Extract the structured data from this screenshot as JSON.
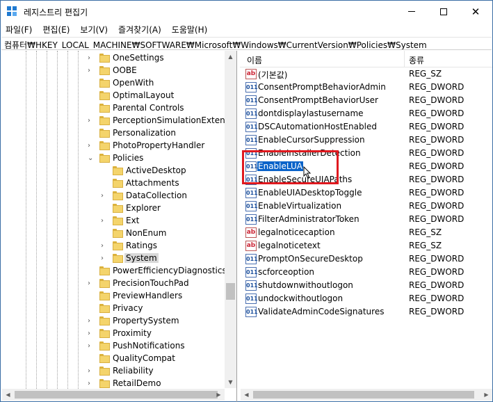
{
  "window": {
    "title": "레지스트리 편집기",
    "brand_color": "#1f7ad1"
  },
  "menu": [
    {
      "label": "파일(F)"
    },
    {
      "label": "편집(E)"
    },
    {
      "label": "보기(V)"
    },
    {
      "label": "즐겨찾기(A)"
    },
    {
      "label": "도움말(H)"
    }
  ],
  "address": {
    "path": "컴퓨터₩HKEY_LOCAL_MACHINE₩SOFTWARE₩Microsoft₩Windows₩CurrentVersion₩Policies₩System"
  },
  "tree": {
    "items": [
      {
        "label": "OneSettings",
        "level": 0,
        "expander": "collapsed"
      },
      {
        "label": "OOBE",
        "level": 0,
        "expander": "collapsed"
      },
      {
        "label": "OpenWith",
        "level": 0,
        "expander": "none"
      },
      {
        "label": "OptimalLayout",
        "level": 0,
        "expander": "none"
      },
      {
        "label": "Parental Controls",
        "level": 0,
        "expander": "none"
      },
      {
        "label": "PerceptionSimulationExtensions",
        "level": 0,
        "expander": "collapsed"
      },
      {
        "label": "Personalization",
        "level": 0,
        "expander": "none"
      },
      {
        "label": "PhotoPropertyHandler",
        "level": 0,
        "expander": "collapsed"
      },
      {
        "label": "Policies",
        "level": 0,
        "expander": "expanded"
      },
      {
        "label": "ActiveDesktop",
        "level": 1,
        "expander": "none"
      },
      {
        "label": "Attachments",
        "level": 1,
        "expander": "none"
      },
      {
        "label": "DataCollection",
        "level": 1,
        "expander": "collapsed"
      },
      {
        "label": "Explorer",
        "level": 1,
        "expander": "none"
      },
      {
        "label": "Ext",
        "level": 1,
        "expander": "collapsed"
      },
      {
        "label": "NonEnum",
        "level": 1,
        "expander": "none"
      },
      {
        "label": "Ratings",
        "level": 1,
        "expander": "collapsed"
      },
      {
        "label": "System",
        "level": 1,
        "expander": "collapsed",
        "selected": true
      },
      {
        "label": "PowerEfficiencyDiagnostics",
        "level": 0,
        "expander": "none"
      },
      {
        "label": "PrecisionTouchPad",
        "level": 0,
        "expander": "collapsed"
      },
      {
        "label": "PreviewHandlers",
        "level": 0,
        "expander": "none"
      },
      {
        "label": "Privacy",
        "level": 0,
        "expander": "none"
      },
      {
        "label": "PropertySystem",
        "level": 0,
        "expander": "collapsed"
      },
      {
        "label": "Proximity",
        "level": 0,
        "expander": "collapsed"
      },
      {
        "label": "PushNotifications",
        "level": 0,
        "expander": "collapsed"
      },
      {
        "label": "QualityCompat",
        "level": 0,
        "expander": "none"
      },
      {
        "label": "Reliability",
        "level": 0,
        "expander": "collapsed"
      },
      {
        "label": "RetailDemo",
        "level": 0,
        "expander": "collapsed"
      }
    ]
  },
  "list": {
    "columns": {
      "name": "이름",
      "type": "종류"
    },
    "values": [
      {
        "name": "(기본값)",
        "type": "REG_SZ",
        "kind": "sz"
      },
      {
        "name": "ConsentPromptBehaviorAdmin",
        "type": "REG_DWORD",
        "kind": "dword"
      },
      {
        "name": "ConsentPromptBehaviorUser",
        "type": "REG_DWORD",
        "kind": "dword"
      },
      {
        "name": "dontdisplaylastusername",
        "type": "REG_DWORD",
        "kind": "dword"
      },
      {
        "name": "DSCAutomationHostEnabled",
        "type": "REG_DWORD",
        "kind": "dword"
      },
      {
        "name": "EnableCursorSuppression",
        "type": "REG_DWORD",
        "kind": "dword"
      },
      {
        "name": "EnableInstallerDetection",
        "type": "REG_DWORD",
        "kind": "dword"
      },
      {
        "name": "EnableLUA",
        "type": "REG_DWORD",
        "kind": "dword",
        "selected": true
      },
      {
        "name": "EnableSecureUIAPaths",
        "type": "REG_DWORD",
        "kind": "dword"
      },
      {
        "name": "EnableUIADesktopToggle",
        "type": "REG_DWORD",
        "kind": "dword"
      },
      {
        "name": "EnableVirtualization",
        "type": "REG_DWORD",
        "kind": "dword"
      },
      {
        "name": "FilterAdministratorToken",
        "type": "REG_DWORD",
        "kind": "dword"
      },
      {
        "name": "legalnoticecaption",
        "type": "REG_SZ",
        "kind": "sz"
      },
      {
        "name": "legalnoticetext",
        "type": "REG_SZ",
        "kind": "sz"
      },
      {
        "name": "PromptOnSecureDesktop",
        "type": "REG_DWORD",
        "kind": "dword"
      },
      {
        "name": "scforceoption",
        "type": "REG_DWORD",
        "kind": "dword"
      },
      {
        "name": "shutdownwithoutlogon",
        "type": "REG_DWORD",
        "kind": "dword"
      },
      {
        "name": "undockwithoutlogon",
        "type": "REG_DWORD",
        "kind": "dword"
      },
      {
        "name": "ValidateAdminCodeSignatures",
        "type": "REG_DWORD",
        "kind": "dword"
      }
    ],
    "icon_labels": {
      "sz": "ab",
      "dword": "011"
    }
  },
  "highlight_color": "#e0191f",
  "selection_color": "#0a63c9"
}
